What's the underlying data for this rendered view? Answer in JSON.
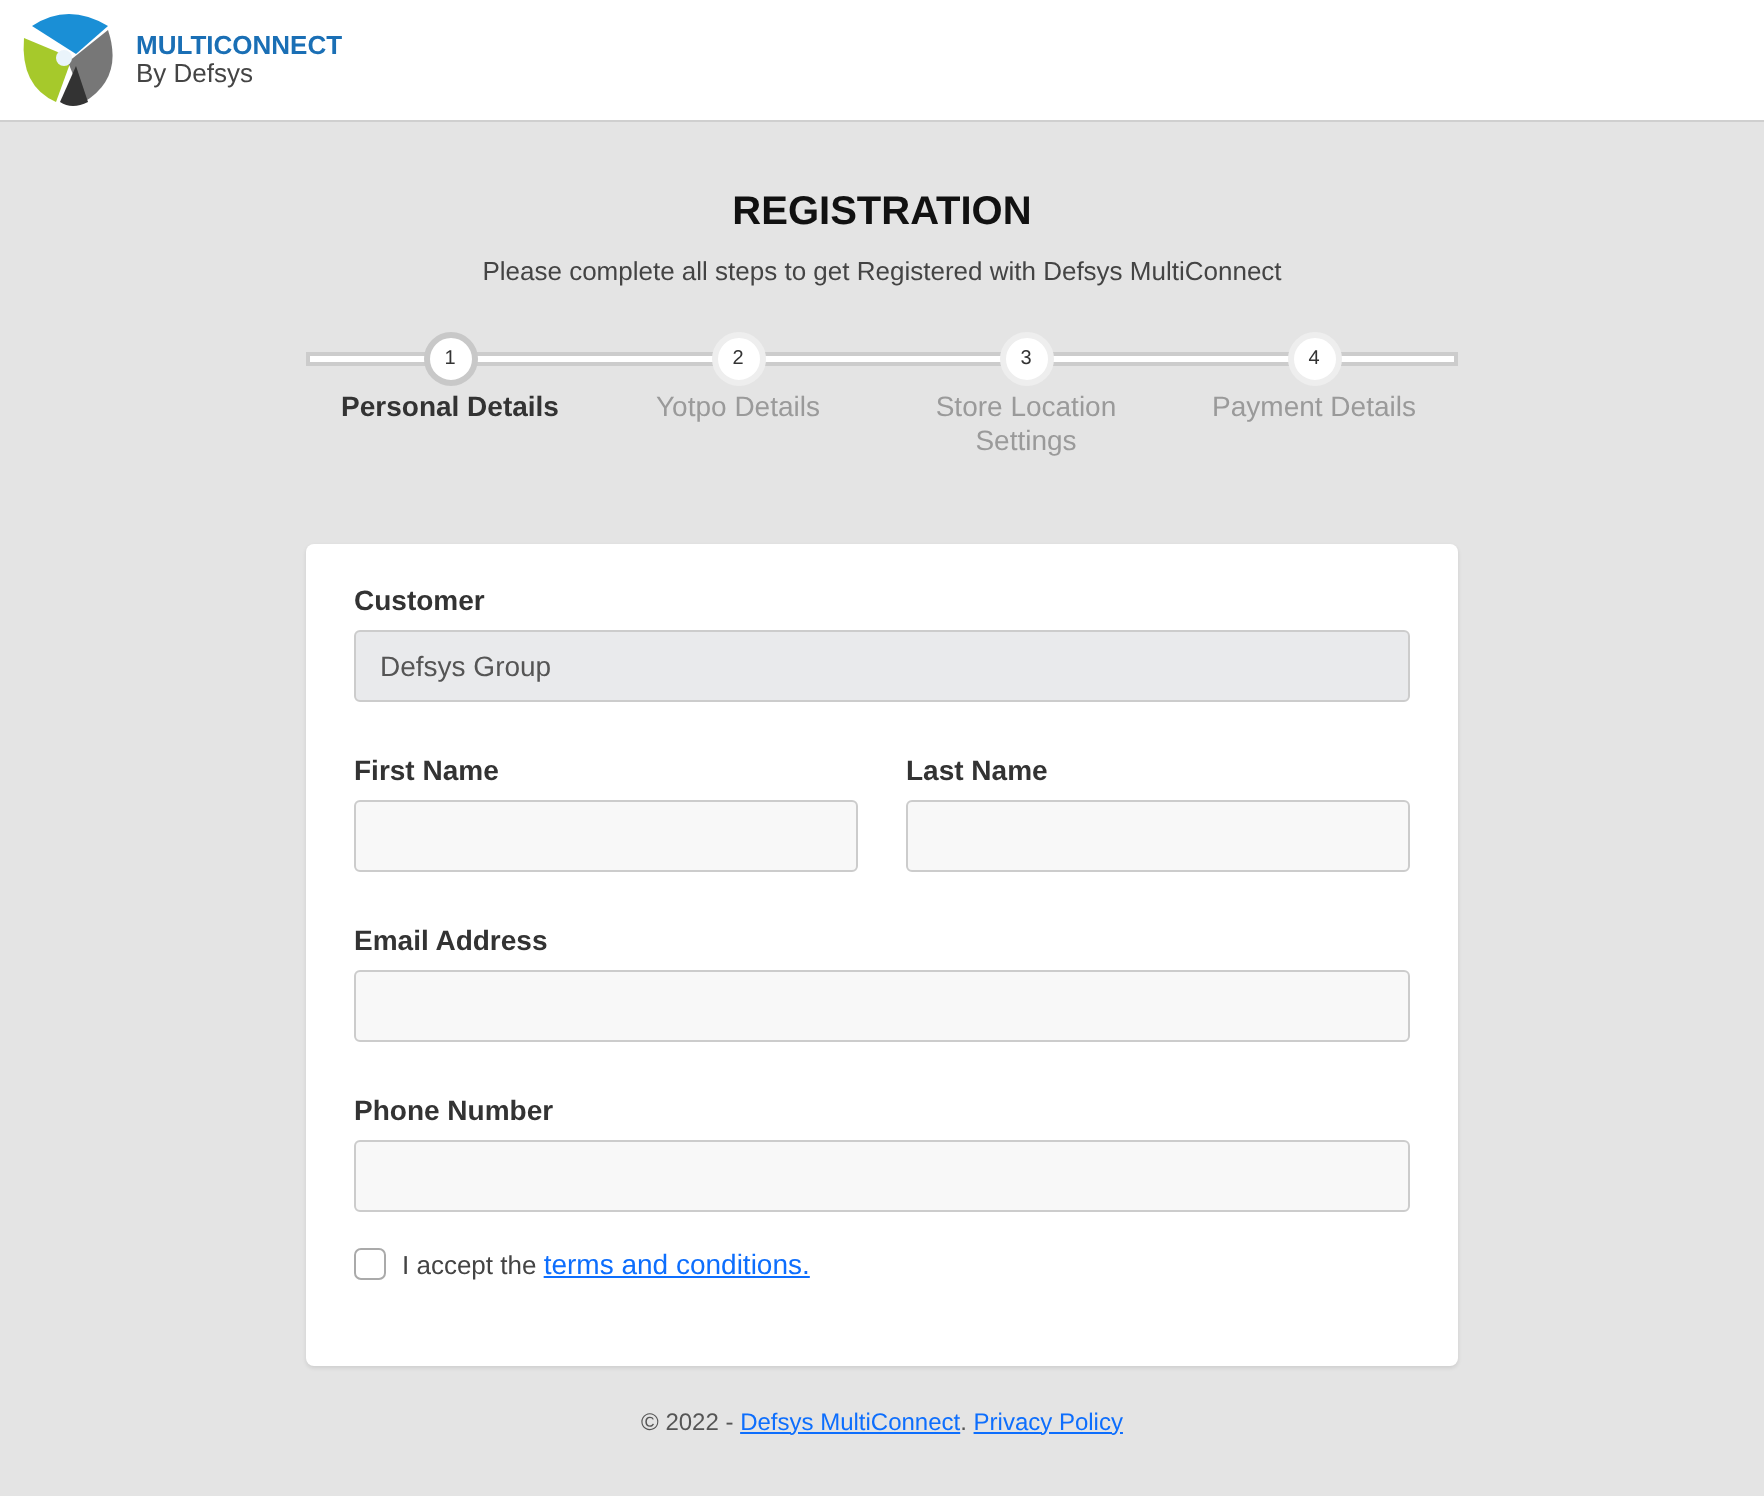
{
  "logo": {
    "name": "MULTICONNECT",
    "tagline": "By Defsys"
  },
  "title": "REGISTRATION",
  "subtitle": "Please complete all steps to get Registered with Defsys MultiConnect",
  "steps": [
    {
      "number": "1",
      "label": "Personal Details",
      "selected": true
    },
    {
      "number": "2",
      "label": "Yotpo Details",
      "selected": false
    },
    {
      "number": "3",
      "label": "Store Location Settings",
      "selected": false
    },
    {
      "number": "4",
      "label": "Payment Details",
      "selected": false
    }
  ],
  "form": {
    "rows": [
      [
        {
          "label": "Customer",
          "value": "Defsys Group",
          "disabled": true
        }
      ],
      [
        {
          "label": "First Name",
          "disabled": false
        },
        {
          "label": "Last Name",
          "disabled": false
        }
      ],
      [
        {
          "label": "Email Address",
          "disabled": false
        }
      ],
      [
        {
          "label": "Phone Number",
          "disabled": false
        }
      ]
    ],
    "terms": {
      "text": "I accept the",
      "link": "terms and conditions.",
      "checked": false
    }
  },
  "footer": {
    "copyright": "© 2022 -",
    "company_link": "Defsys MultiConnect",
    "separator": ".",
    "privacy_link": "Privacy Policy"
  }
}
